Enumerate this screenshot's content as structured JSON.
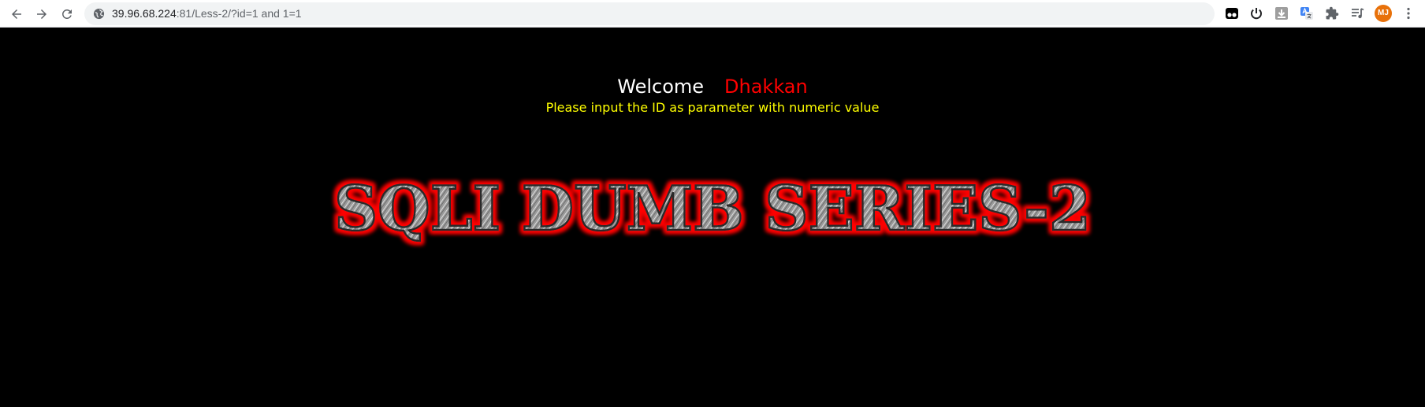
{
  "browser": {
    "url_host": "39.96.68.224",
    "url_rest": ":81/Less-2/?id=1 and 1=1",
    "avatar_initials": "MJ",
    "accent_avatar": "#e8710a"
  },
  "page": {
    "welcome_label": "Welcome",
    "welcome_name": "Dhakkan",
    "instruction": "Please input the ID as parameter with numeric value",
    "banner_title": "SQLI DUMB SERIES-2",
    "colors": {
      "background": "#000000",
      "welcome": "#ffffff",
      "name": "#ff0000",
      "instruction": "#ffff00"
    }
  }
}
